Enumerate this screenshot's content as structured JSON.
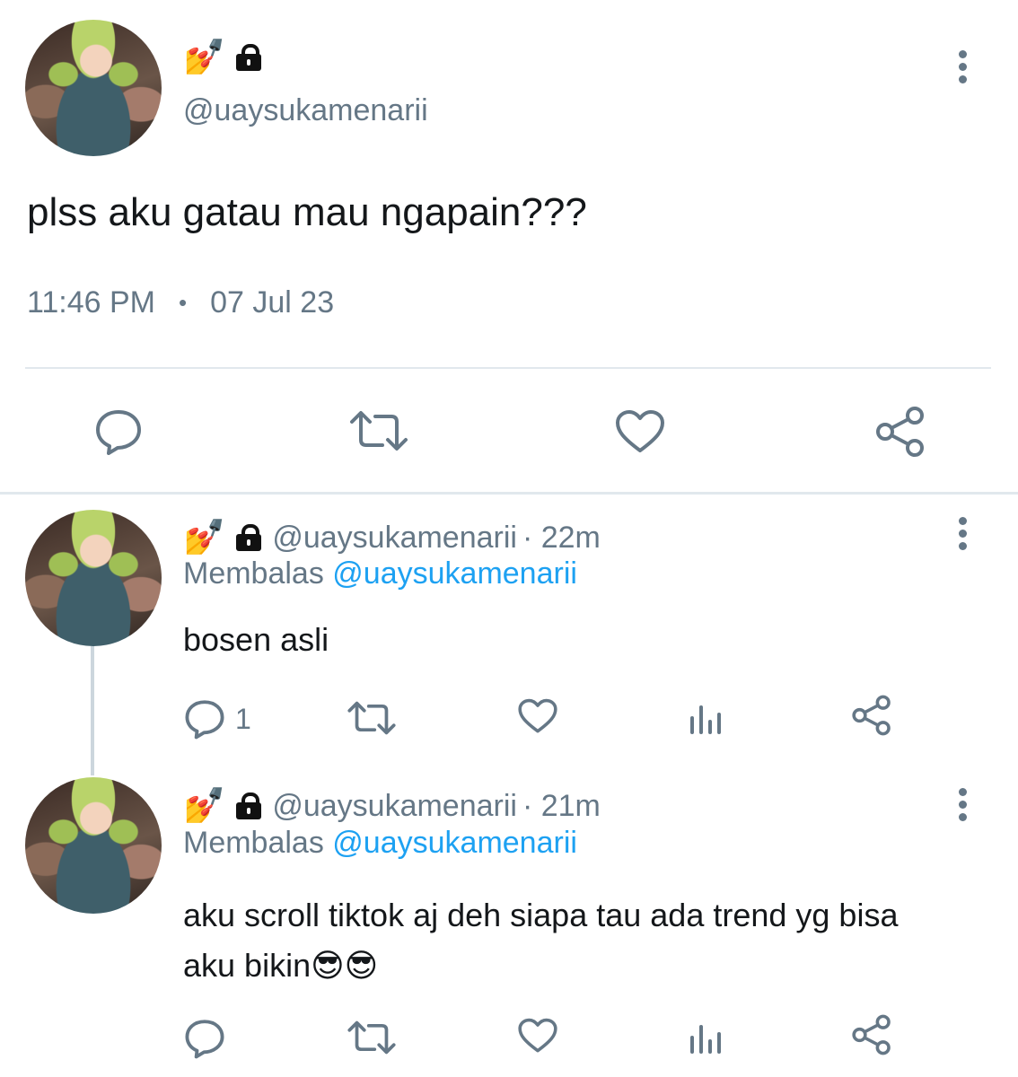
{
  "main_tweet": {
    "handle": "@uaysukamenarii",
    "text": "plss aku gatau mau ngapain???",
    "time": "11:46 PM",
    "separator": "•",
    "date": "07 Jul 23"
  },
  "replies": [
    {
      "handle": "@uaysukamenarii",
      "age": "· 22m",
      "replying_prefix": "Membalas",
      "replying_to": "@uaysukamenarii",
      "text": "bosen asli",
      "reply_count": "1"
    },
    {
      "handle": "@uaysukamenarii",
      "age": "· 21m",
      "replying_prefix": "Membalas",
      "replying_to": "@uaysukamenarii",
      "text_line1": "aku scroll tiktok aj deh siapa tau ada trend yg bisa",
      "text_line2": "aku bikin😎😎"
    }
  ],
  "name_emoji": "💅",
  "icons": {
    "reply": "reply-bubble-icon",
    "retweet": "retweet-icon",
    "like": "heart-icon",
    "share": "share-icon",
    "stats": "analytics-icon",
    "more": "kebab-menu-icon",
    "lock": "lock-icon"
  },
  "colors": {
    "text": "#14171a",
    "muted": "#657786",
    "link": "#1da1f2",
    "divider": "#e1e8ed"
  }
}
